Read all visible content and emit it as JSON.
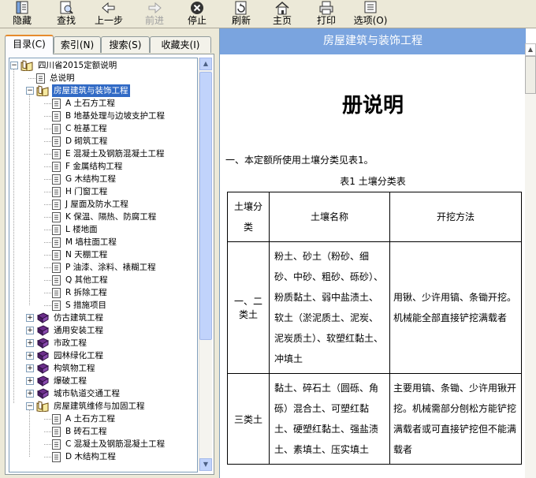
{
  "toolbar": {
    "buttons": [
      {
        "label": "隐藏",
        "icon": "hide-pane-icon",
        "enabled": true
      },
      {
        "label": "查找",
        "icon": "find-icon",
        "enabled": true
      },
      {
        "label": "上一步",
        "icon": "back-arrow-icon",
        "enabled": true
      },
      {
        "label": "前进",
        "icon": "forward-arrow-icon",
        "enabled": false
      },
      {
        "label": "停止",
        "icon": "stop-icon",
        "enabled": true
      },
      {
        "label": "刷新",
        "icon": "refresh-icon",
        "enabled": true
      },
      {
        "label": "主页",
        "icon": "home-icon",
        "enabled": true
      },
      {
        "label": "打印",
        "icon": "print-icon",
        "enabled": true
      },
      {
        "label": "选项(O)",
        "icon": "options-icon",
        "enabled": true
      }
    ]
  },
  "nav_tabs": [
    {
      "label": "目录(C)",
      "active": true
    },
    {
      "label": "索引(N)",
      "active": false
    },
    {
      "label": "搜索(S)",
      "active": false
    },
    {
      "label": "收藏夹(I)",
      "active": false
    }
  ],
  "tree": {
    "items": [
      {
        "label": "四川省2015定额说明",
        "level": 0,
        "type": "book-open",
        "expander": "minus"
      },
      {
        "label": "总说明",
        "level": 1,
        "type": "page"
      },
      {
        "label": "房屋建筑与装饰工程",
        "level": 1,
        "type": "book-open",
        "expander": "minus",
        "selected": true
      },
      {
        "label": "A 土石方工程",
        "level": 2,
        "type": "page"
      },
      {
        "label": "B 地基处理与边坡支护工程",
        "level": 2,
        "type": "page"
      },
      {
        "label": "C 桩基工程",
        "level": 2,
        "type": "page"
      },
      {
        "label": "D 砌筑工程",
        "level": 2,
        "type": "page"
      },
      {
        "label": "E 混凝土及钢筋混凝土工程",
        "level": 2,
        "type": "page"
      },
      {
        "label": "F 金属结构工程",
        "level": 2,
        "type": "page"
      },
      {
        "label": "G 木结构工程",
        "level": 2,
        "type": "page"
      },
      {
        "label": "H 门窗工程",
        "level": 2,
        "type": "page"
      },
      {
        "label": "J 屋面及防水工程",
        "level": 2,
        "type": "page"
      },
      {
        "label": "K 保温、隔热、防腐工程",
        "level": 2,
        "type": "page"
      },
      {
        "label": "L 楼地面",
        "level": 2,
        "type": "page"
      },
      {
        "label": "M 墙柱面工程",
        "level": 2,
        "type": "page"
      },
      {
        "label": "N 天棚工程",
        "level": 2,
        "type": "page"
      },
      {
        "label": "P 油漆、涂料、裱糊工程",
        "level": 2,
        "type": "page"
      },
      {
        "label": "Q 其他工程",
        "level": 2,
        "type": "page"
      },
      {
        "label": "R 拆除工程",
        "level": 2,
        "type": "page"
      },
      {
        "label": "S 措施项目",
        "level": 2,
        "type": "page"
      },
      {
        "label": "仿古建筑工程",
        "level": 1,
        "type": "book-closed",
        "expander": "plus"
      },
      {
        "label": "通用安装工程",
        "level": 1,
        "type": "book-closed",
        "expander": "plus"
      },
      {
        "label": "市政工程",
        "level": 1,
        "type": "book-closed",
        "expander": "plus"
      },
      {
        "label": "园林绿化工程",
        "level": 1,
        "type": "book-closed",
        "expander": "plus"
      },
      {
        "label": "构筑物工程",
        "level": 1,
        "type": "book-closed",
        "expander": "plus"
      },
      {
        "label": "爆破工程",
        "level": 1,
        "type": "book-closed",
        "expander": "plus"
      },
      {
        "label": "城市轨道交通工程",
        "level": 1,
        "type": "book-closed",
        "expander": "plus"
      },
      {
        "label": "房屋建筑维修与加固工程",
        "level": 1,
        "type": "book-open",
        "expander": "minus"
      },
      {
        "label": "A 土石方工程",
        "level": 2,
        "type": "page"
      },
      {
        "label": "B 砖石工程",
        "level": 2,
        "type": "page"
      },
      {
        "label": "C 混凝土及钢筋混凝土工程",
        "level": 2,
        "type": "page"
      },
      {
        "label": "D 木结构工程",
        "level": 2,
        "type": "page"
      }
    ]
  },
  "document": {
    "header": "房屋建筑与装饰工程",
    "title": "册说明",
    "paragraph": "一、本定额所使用土壤分类见表1。",
    "table_caption": "表1  土壤分类表",
    "table": {
      "headers": [
        "土壤分类",
        "土壤名称",
        "开挖方法"
      ],
      "rows": [
        {
          "class": "一、二类土",
          "names": "粉土、砂土（粉砂、细砂、中砂、粗砂、砾砂）、粉质黏土、弱中盐渍土、软土（淤泥质土、泥炭、泥炭质土）、软塑红黏土、冲填土",
          "method": "用锹、少许用镐、条锄开挖。机械能全部直接铲挖满载者"
        },
        {
          "class": "三类土",
          "names": "黏土、碎石土（圆砾、角砾）混合土、可塑红黏土、硬塑红黏土、强盐渍土、素填土、压实填土",
          "method": "主要用镐、条锄、少许用锹开挖。机械需部分刨松方能铲挖满载者或可直接铲挖但不能满载者"
        }
      ]
    }
  },
  "colors": {
    "window_bg": "#ece9d8",
    "doc_header_bg": "#7aa4df",
    "selection_bg": "#316ac5",
    "book_closed": "#6b2d8a"
  }
}
